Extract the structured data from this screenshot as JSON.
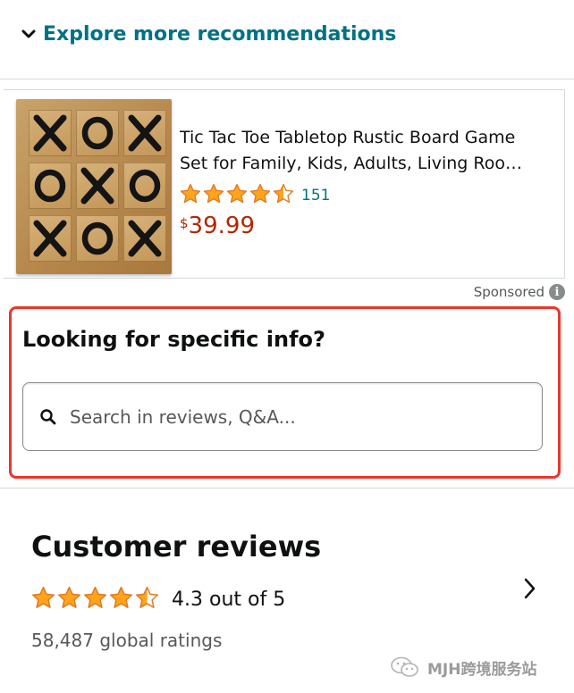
{
  "explore": {
    "label": "Explore more recommendations",
    "icon": "chevron-down-icon"
  },
  "product": {
    "image_icon": "tic-tac-toe-board-image",
    "board": [
      [
        "X",
        "O",
        "X"
      ],
      [
        "O",
        "X",
        "O"
      ],
      [
        "X",
        "O",
        "X"
      ]
    ],
    "title_line1": "Tic Tac Toe Tabletop Rustic Board Game",
    "title_line2": "Set for Family, Kids, Adults, Living Roo…",
    "rating": 4.5,
    "rating_count": "151",
    "price_symbol": "$",
    "price": "39.99"
  },
  "sponsored": {
    "label": "Sponsored",
    "icon": "info-icon"
  },
  "search_section": {
    "heading": "Looking for specific info?",
    "placeholder": "Search in reviews, Q&A...",
    "icon": "search-icon"
  },
  "reviews": {
    "title": "Customer reviews",
    "rating": 4.5,
    "rating_text": "4.3 out of 5",
    "global_ratings": "58,487 global ratings"
  },
  "watermark": {
    "text": "MJH跨境服务站"
  },
  "colors": {
    "link": "#007185",
    "price": "#b12704",
    "star": "#ffa41c",
    "highlight": "#e8372c",
    "text": "#0f1111",
    "secondary": "#565959"
  }
}
